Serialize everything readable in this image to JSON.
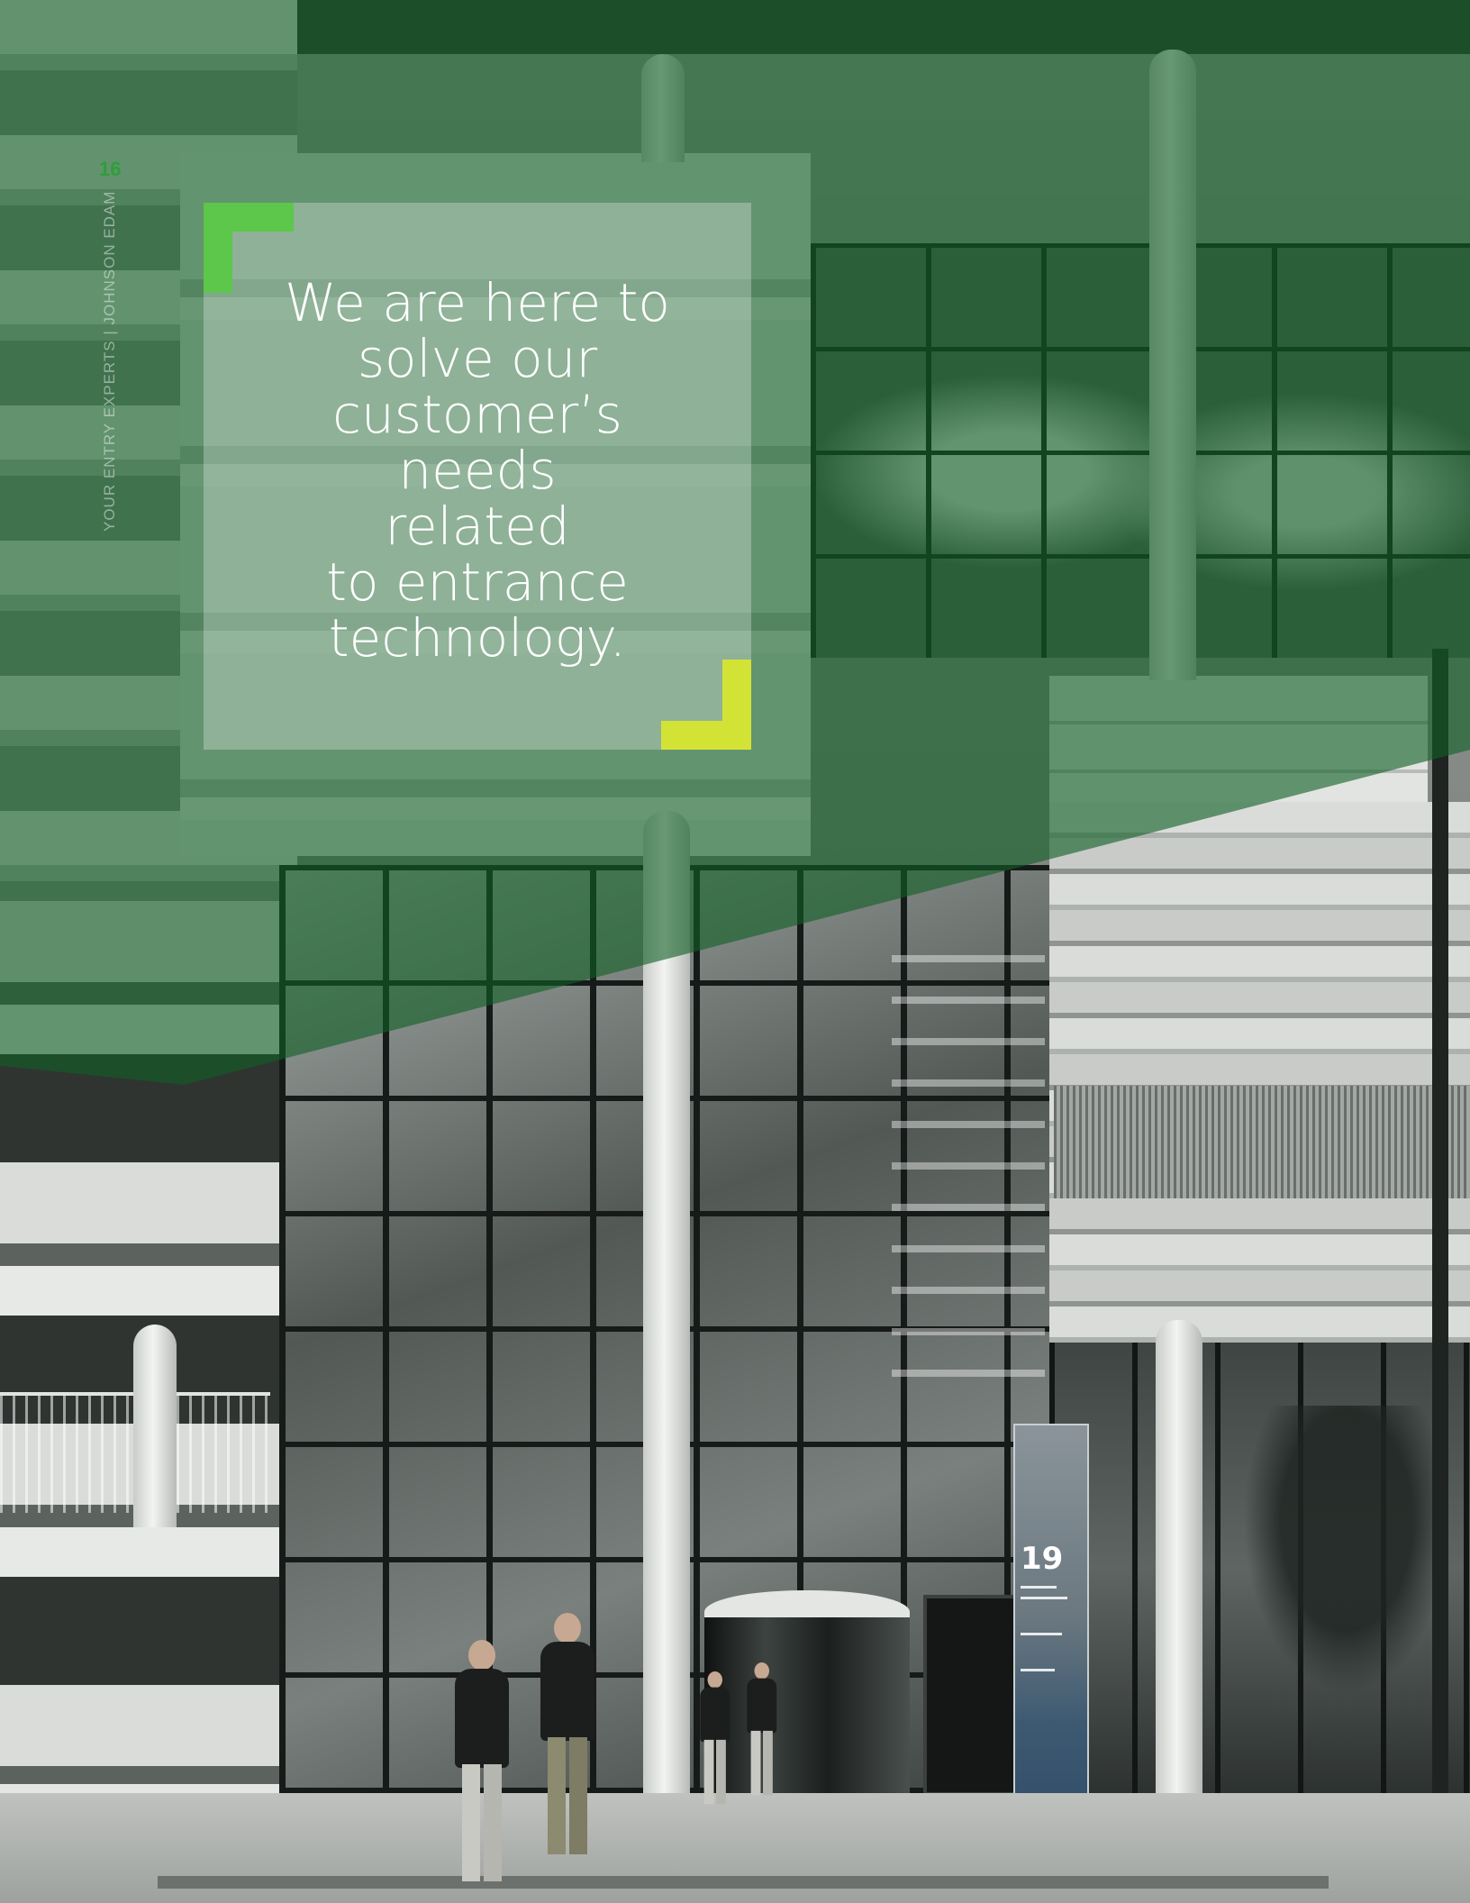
{
  "page": {
    "number": "16",
    "running_header": "YOUR ENTRY EXPERTS | JOHNSON EDAM"
  },
  "quote": {
    "lines": [
      "We are here to",
      "solve our",
      "customer’s",
      "needs",
      "related",
      "to entrance",
      "technology."
    ]
  },
  "photo": {
    "building_number": "19"
  },
  "colors": {
    "overlay_green": "#126026",
    "bracket_green": "#5cc74b",
    "bracket_yellow": "#d3e336",
    "page_number": "#2f9e3a"
  }
}
